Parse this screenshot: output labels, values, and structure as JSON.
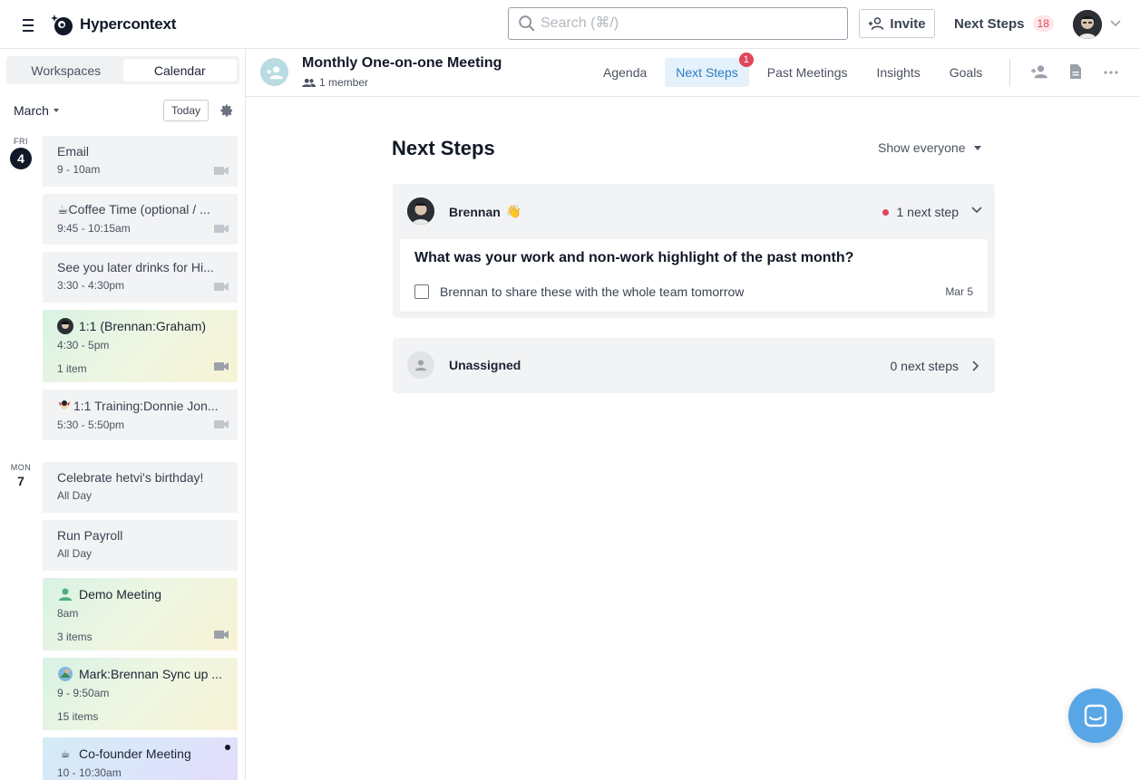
{
  "app": {
    "name": "Hypercontext",
    "search_placeholder": "Search (⌘/)",
    "invite_label": "Invite",
    "next_steps_label": "Next Steps",
    "next_steps_count": "18"
  },
  "sidebar": {
    "tabs": [
      "Workspaces",
      "Calendar"
    ],
    "active_tab": "Calendar",
    "month": "March",
    "today_label": "Today",
    "days": [
      {
        "dow": "FRI",
        "num": "4"
      },
      {
        "dow": "MON",
        "num": "7"
      }
    ],
    "events": [
      {
        "title": "Email",
        "time": "9 - 10am",
        "items": ""
      },
      {
        "title": "☕Coffee Time (optional / ...",
        "time": "9:45 - 10:15am",
        "items": ""
      },
      {
        "title": "See you later drinks for Hi...",
        "time": "3:30 - 4:30pm",
        "items": ""
      },
      {
        "title": "1:1 (Brennan:Graham)",
        "time": "4:30 - 5pm",
        "items": "1 item"
      },
      {
        "title": "1:1 Training:Donnie Jon...",
        "time": "5:30 - 5:50pm",
        "items": ""
      },
      {
        "title": "Celebrate hetvi's birthday!",
        "time": "All Day",
        "items": ""
      },
      {
        "title": "Run Payroll",
        "time": "All Day",
        "items": ""
      },
      {
        "title": "Demo Meeting",
        "time": "8am",
        "items": "3 items"
      },
      {
        "title": "Mark:Brennan Sync up ...",
        "time": "9 - 9:50am",
        "items": "15 items"
      },
      {
        "title": "Co-founder Meeting",
        "time": "10 - 10:30am",
        "items": ""
      }
    ]
  },
  "meeting": {
    "title": "Monthly One-on-one Meeting",
    "members": "1 member",
    "tabs": [
      "Agenda",
      "Next Steps",
      "Past Meetings",
      "Insights",
      "Goals"
    ],
    "active_tab": "Next Steps",
    "next_steps_badge": "1"
  },
  "main": {
    "title": "Next Steps",
    "filter": "Show everyone",
    "groups": [
      {
        "name": "Brennan",
        "emoji": "👋",
        "count_label": "1 next step",
        "question": "What was your work and non-work highlight of the past month?",
        "step_text": "Brennan to share these with the whole team tomorrow",
        "step_date": "Mar 5"
      },
      {
        "name": "Unassigned",
        "count_label": "0 next steps"
      }
    ]
  },
  "colors": {
    "accent": "#2b7fc4",
    "badge_red": "#e0455b",
    "chat_blue": "#59a6e6"
  }
}
